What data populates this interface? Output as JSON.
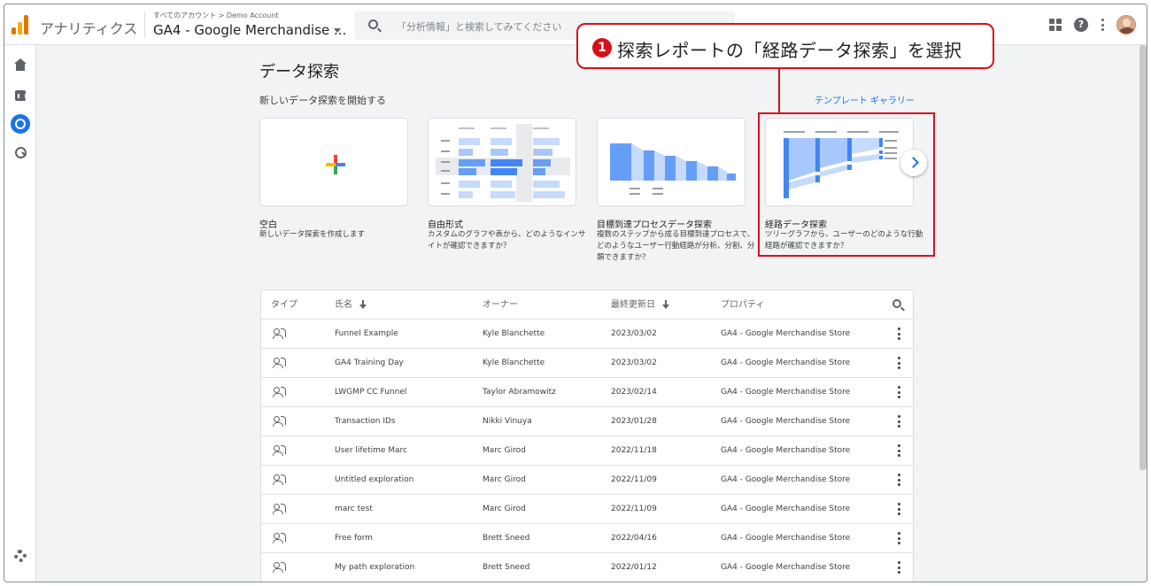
{
  "header": {
    "app_name": "アナリティクス",
    "account_path": "すべてのアカウント > Demo Account",
    "property_name": "GA4 - Google Merchandise ...",
    "search_placeholder": "「分析情報」と検索してみてください"
  },
  "page": {
    "title": "データ探索",
    "subtitle": "新しいデータ探索を開始する",
    "gallery_link": "テンプレート ギャラリー"
  },
  "cards": [
    {
      "title": "空白",
      "desc": "新しいデータ探索を作成します"
    },
    {
      "title": "自由形式",
      "desc": "カスタムのグラフや表から、どのようなインサイトが確認できますか？"
    },
    {
      "title": "目標到達プロセスデータ探索",
      "desc": "複数のステップから成る目標到達プロセスで、どのようなユーザー行動経路が分析、分割、分類できますか？"
    },
    {
      "title": "経路データ探索",
      "desc": "ツリーグラフから、ユーザーのどのような行動経路が確認できますか？"
    }
  ],
  "annotation": {
    "number": "1",
    "text": "探索レポートの「経路データ探索」を選択"
  },
  "table": {
    "headers": {
      "type": "タイプ",
      "name": "氏名",
      "owner": "オーナー",
      "modified": "最終更新日",
      "property": "プロパティ"
    },
    "rows": [
      {
        "name": "Funnel Example",
        "owner": "Kyle Blanchette",
        "date": "2023/03/02",
        "property": "GA4 - Google Merchandise Store"
      },
      {
        "name": "GA4 Training Day",
        "owner": "Kyle Blanchette",
        "date": "2023/03/02",
        "property": "GA4 - Google Merchandise Store"
      },
      {
        "name": "LWGMP CC Funnel",
        "owner": "Taylor Abramowitz",
        "date": "2023/02/14",
        "property": "GA4 - Google Merchandise Store"
      },
      {
        "name": "Transaction IDs",
        "owner": "Nikki Vinuya",
        "date": "2023/01/28",
        "property": "GA4 - Google Merchandise Store"
      },
      {
        "name": "User lifetime Marc",
        "owner": "Marc Girod",
        "date": "2022/11/18",
        "property": "GA4 - Google Merchandise Store"
      },
      {
        "name": "Untitled exploration",
        "owner": "Marc Girod",
        "date": "2022/11/09",
        "property": "GA4 - Google Merchandise Store"
      },
      {
        "name": "marc test",
        "owner": "Marc Girod",
        "date": "2022/11/09",
        "property": "GA4 - Google Merchandise Store"
      },
      {
        "name": "Free form",
        "owner": "Brett Sneed",
        "date": "2022/04/16",
        "property": "GA4 - Google Merchandise Store"
      },
      {
        "name": "My path exploration",
        "owner": "Brett Sneed",
        "date": "2022/01/12",
        "property": "GA4 - Google Merchandise Store"
      }
    ]
  },
  "colors": {
    "accent": "#1a73e8",
    "annotation_red": "#d7101b"
  }
}
